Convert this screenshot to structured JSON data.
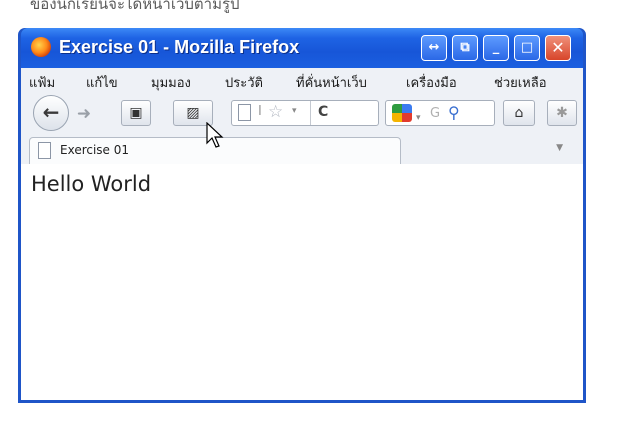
{
  "caption": "ของนักเรียนจะได้หน้าเว็บตามรูป",
  "window": {
    "title": "Exercise 01 - Mozilla Firefox",
    "buttons": {
      "extra1": "↔",
      "extra2": "⧉",
      "minimize": "_",
      "maximize": "□",
      "close": "✕"
    }
  },
  "menu": [
    "แฟ้ม",
    "แก้ไข",
    "มุมมอง",
    "ประวัติ",
    "ที่คั่นหน้าเว็บ",
    "เครื่องมือ",
    "ช่วยเหลือ"
  ],
  "toolbar": {
    "back_icon": "arrow-left-icon",
    "forward_icon": "arrow-right-icon",
    "reload_glyph": "C",
    "search_placeholder": "G",
    "home_icon": "home-icon"
  },
  "tab": {
    "label": "Exercise 01"
  },
  "page": {
    "body_text": "Hello World"
  }
}
